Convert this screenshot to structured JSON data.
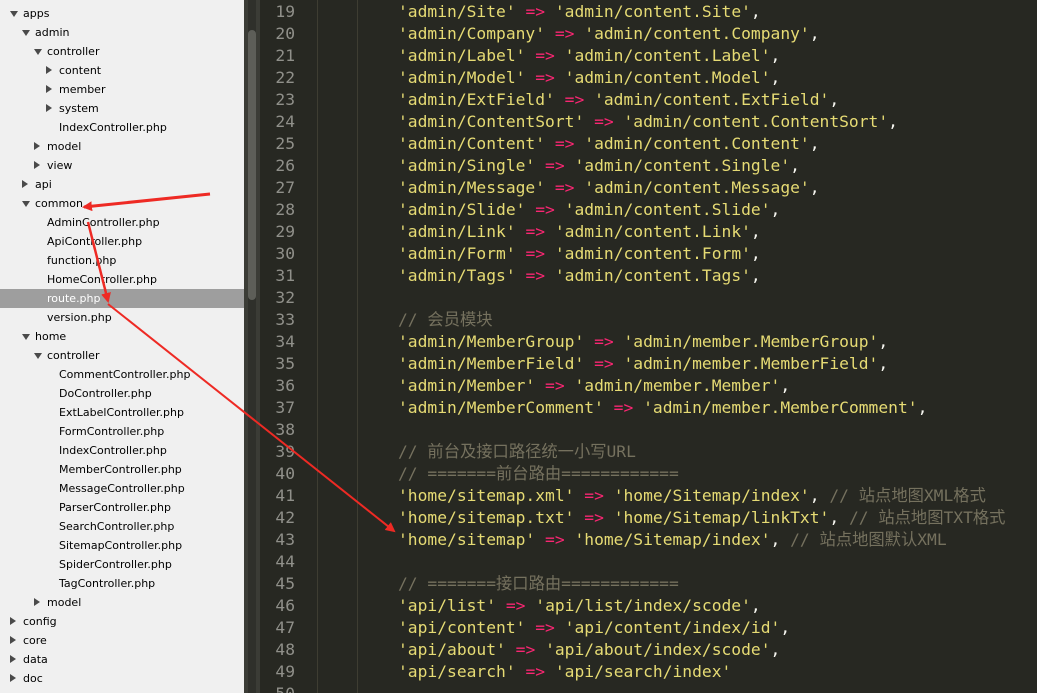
{
  "sidebar": {
    "items": [
      {
        "label": "apps",
        "state": "open",
        "selected": false
      },
      {
        "label": "admin",
        "state": "open",
        "selected": false
      },
      {
        "label": "controller",
        "state": "open",
        "selected": false
      },
      {
        "label": "content",
        "state": "closed",
        "selected": false
      },
      {
        "label": "member",
        "state": "closed",
        "selected": false
      },
      {
        "label": "system",
        "state": "closed",
        "selected": false
      },
      {
        "label": "IndexController.php",
        "state": "file",
        "selected": false
      },
      {
        "label": "model",
        "state": "closed",
        "selected": false
      },
      {
        "label": "view",
        "state": "closed",
        "selected": false
      },
      {
        "label": "api",
        "state": "closed",
        "selected": false
      },
      {
        "label": "common",
        "state": "open",
        "selected": false
      },
      {
        "label": "AdminController.php",
        "state": "file",
        "selected": false
      },
      {
        "label": "ApiController.php",
        "state": "file",
        "selected": false
      },
      {
        "label": "function.php",
        "state": "file",
        "selected": false
      },
      {
        "label": "HomeController.php",
        "state": "file",
        "selected": false
      },
      {
        "label": "route.php",
        "state": "file",
        "selected": true
      },
      {
        "label": "version.php",
        "state": "file",
        "selected": false
      },
      {
        "label": "home",
        "state": "open",
        "selected": false
      },
      {
        "label": "controller",
        "state": "open",
        "selected": false
      },
      {
        "label": "CommentController.php",
        "state": "file",
        "selected": false
      },
      {
        "label": "DoController.php",
        "state": "file",
        "selected": false
      },
      {
        "label": "ExtLabelController.php",
        "state": "file",
        "selected": false
      },
      {
        "label": "FormController.php",
        "state": "file",
        "selected": false
      },
      {
        "label": "IndexController.php",
        "state": "file",
        "selected": false
      },
      {
        "label": "MemberController.php",
        "state": "file",
        "selected": false
      },
      {
        "label": "MessageController.php",
        "state": "file",
        "selected": false
      },
      {
        "label": "ParserController.php",
        "state": "file",
        "selected": false
      },
      {
        "label": "SearchController.php",
        "state": "file",
        "selected": false
      },
      {
        "label": "SitemapController.php",
        "state": "file",
        "selected": false
      },
      {
        "label": "SpiderController.php",
        "state": "file",
        "selected": false
      },
      {
        "label": "TagController.php",
        "state": "file",
        "selected": false
      },
      {
        "label": "model",
        "state": "closed",
        "selected": false
      },
      {
        "label": "config",
        "state": "closed",
        "selected": false
      },
      {
        "label": "core",
        "state": "closed",
        "selected": false
      },
      {
        "label": "data",
        "state": "closed",
        "selected": false
      },
      {
        "label": "doc",
        "state": "closed",
        "selected": false
      }
    ]
  },
  "editor": {
    "lines": [
      {
        "n": "19",
        "parts": [
          [
            "s",
            "'admin/Site'"
          ],
          [
            "p",
            " "
          ],
          [
            "k",
            "=>"
          ],
          [
            "p",
            " "
          ],
          [
            "s",
            "'admin/content.Site'"
          ],
          [
            "p",
            ","
          ]
        ]
      },
      {
        "n": "20",
        "parts": [
          [
            "s",
            "'admin/Company'"
          ],
          [
            "p",
            " "
          ],
          [
            "k",
            "=>"
          ],
          [
            "p",
            " "
          ],
          [
            "s",
            "'admin/content.Company'"
          ],
          [
            "p",
            ","
          ]
        ]
      },
      {
        "n": "21",
        "parts": [
          [
            "s",
            "'admin/Label'"
          ],
          [
            "p",
            " "
          ],
          [
            "k",
            "=>"
          ],
          [
            "p",
            " "
          ],
          [
            "s",
            "'admin/content.Label'"
          ],
          [
            "p",
            ","
          ]
        ]
      },
      {
        "n": "22",
        "parts": [
          [
            "s",
            "'admin/Model'"
          ],
          [
            "p",
            " "
          ],
          [
            "k",
            "=>"
          ],
          [
            "p",
            " "
          ],
          [
            "s",
            "'admin/content.Model'"
          ],
          [
            "p",
            ","
          ]
        ]
      },
      {
        "n": "23",
        "parts": [
          [
            "s",
            "'admin/ExtField'"
          ],
          [
            "p",
            " "
          ],
          [
            "k",
            "=>"
          ],
          [
            "p",
            " "
          ],
          [
            "s",
            "'admin/content.ExtField'"
          ],
          [
            "p",
            ","
          ]
        ]
      },
      {
        "n": "24",
        "parts": [
          [
            "s",
            "'admin/ContentSort'"
          ],
          [
            "p",
            " "
          ],
          [
            "k",
            "=>"
          ],
          [
            "p",
            " "
          ],
          [
            "s",
            "'admin/content.ContentSort'"
          ],
          [
            "p",
            ","
          ]
        ]
      },
      {
        "n": "25",
        "parts": [
          [
            "s",
            "'admin/Content'"
          ],
          [
            "p",
            " "
          ],
          [
            "k",
            "=>"
          ],
          [
            "p",
            " "
          ],
          [
            "s",
            "'admin/content.Content'"
          ],
          [
            "p",
            ","
          ]
        ]
      },
      {
        "n": "26",
        "parts": [
          [
            "s",
            "'admin/Single'"
          ],
          [
            "p",
            " "
          ],
          [
            "k",
            "=>"
          ],
          [
            "p",
            " "
          ],
          [
            "s",
            "'admin/content.Single'"
          ],
          [
            "p",
            ","
          ]
        ]
      },
      {
        "n": "27",
        "parts": [
          [
            "s",
            "'admin/Message'"
          ],
          [
            "p",
            " "
          ],
          [
            "k",
            "=>"
          ],
          [
            "p",
            " "
          ],
          [
            "s",
            "'admin/content.Message'"
          ],
          [
            "p",
            ","
          ]
        ]
      },
      {
        "n": "28",
        "parts": [
          [
            "s",
            "'admin/Slide'"
          ],
          [
            "p",
            " "
          ],
          [
            "k",
            "=>"
          ],
          [
            "p",
            " "
          ],
          [
            "s",
            "'admin/content.Slide'"
          ],
          [
            "p",
            ","
          ]
        ]
      },
      {
        "n": "29",
        "parts": [
          [
            "s",
            "'admin/Link'"
          ],
          [
            "p",
            " "
          ],
          [
            "k",
            "=>"
          ],
          [
            "p",
            " "
          ],
          [
            "s",
            "'admin/content.Link'"
          ],
          [
            "p",
            ","
          ]
        ]
      },
      {
        "n": "30",
        "parts": [
          [
            "s",
            "'admin/Form'"
          ],
          [
            "p",
            " "
          ],
          [
            "k",
            "=>"
          ],
          [
            "p",
            " "
          ],
          [
            "s",
            "'admin/content.Form'"
          ],
          [
            "p",
            ","
          ]
        ]
      },
      {
        "n": "31",
        "parts": [
          [
            "s",
            "'admin/Tags'"
          ],
          [
            "p",
            " "
          ],
          [
            "k",
            "=>"
          ],
          [
            "p",
            " "
          ],
          [
            "s",
            "'admin/content.Tags'"
          ],
          [
            "p",
            ","
          ]
        ]
      },
      {
        "n": "32",
        "parts": []
      },
      {
        "n": "33",
        "parts": [
          [
            "c",
            "// 会员模块"
          ]
        ]
      },
      {
        "n": "34",
        "parts": [
          [
            "s",
            "'admin/MemberGroup'"
          ],
          [
            "p",
            " "
          ],
          [
            "k",
            "=>"
          ],
          [
            "p",
            " "
          ],
          [
            "s",
            "'admin/member.MemberGroup'"
          ],
          [
            "p",
            ","
          ]
        ]
      },
      {
        "n": "35",
        "parts": [
          [
            "s",
            "'admin/MemberField'"
          ],
          [
            "p",
            " "
          ],
          [
            "k",
            "=>"
          ],
          [
            "p",
            " "
          ],
          [
            "s",
            "'admin/member.MemberField'"
          ],
          [
            "p",
            ","
          ]
        ]
      },
      {
        "n": "36",
        "parts": [
          [
            "s",
            "'admin/Member'"
          ],
          [
            "p",
            " "
          ],
          [
            "k",
            "=>"
          ],
          [
            "p",
            " "
          ],
          [
            "s",
            "'admin/member.Member'"
          ],
          [
            "p",
            ","
          ]
        ]
      },
      {
        "n": "37",
        "parts": [
          [
            "s",
            "'admin/MemberComment'"
          ],
          [
            "p",
            " "
          ],
          [
            "k",
            "=>"
          ],
          [
            "p",
            " "
          ],
          [
            "s",
            "'admin/member.MemberComment'"
          ],
          [
            "p",
            ","
          ]
        ]
      },
      {
        "n": "38",
        "parts": []
      },
      {
        "n": "39",
        "parts": [
          [
            "c",
            "// 前台及接口路径统一小写URL"
          ]
        ]
      },
      {
        "n": "40",
        "parts": [
          [
            "c",
            "// =======前台路由============"
          ]
        ]
      },
      {
        "n": "41",
        "parts": [
          [
            "s",
            "'home/sitemap.xml'"
          ],
          [
            "p",
            " "
          ],
          [
            "k",
            "=>"
          ],
          [
            "p",
            " "
          ],
          [
            "s",
            "'home/Sitemap/index'"
          ],
          [
            "p",
            ", "
          ],
          [
            "c",
            "// 站点地图XML格式"
          ]
        ]
      },
      {
        "n": "42",
        "parts": [
          [
            "s",
            "'home/sitemap.txt'"
          ],
          [
            "p",
            " "
          ],
          [
            "k",
            "=>"
          ],
          [
            "p",
            " "
          ],
          [
            "s",
            "'home/Sitemap/linkTxt'"
          ],
          [
            "p",
            ", "
          ],
          [
            "c",
            "// 站点地图TXT格式"
          ]
        ]
      },
      {
        "n": "43",
        "parts": [
          [
            "s",
            "'home/sitemap'"
          ],
          [
            "p",
            " "
          ],
          [
            "k",
            "=>"
          ],
          [
            "p",
            " "
          ],
          [
            "s",
            "'home/Sitemap/index'"
          ],
          [
            "p",
            ", "
          ],
          [
            "c",
            "// 站点地图默认XML"
          ]
        ]
      },
      {
        "n": "44",
        "parts": []
      },
      {
        "n": "45",
        "parts": [
          [
            "c",
            "// =======接口路由============"
          ]
        ]
      },
      {
        "n": "46",
        "parts": [
          [
            "s",
            "'api/list'"
          ],
          [
            "p",
            " "
          ],
          [
            "k",
            "=>"
          ],
          [
            "p",
            " "
          ],
          [
            "s",
            "'api/list/index/scode'"
          ],
          [
            "p",
            ","
          ]
        ]
      },
      {
        "n": "47",
        "parts": [
          [
            "s",
            "'api/content'"
          ],
          [
            "p",
            " "
          ],
          [
            "k",
            "=>"
          ],
          [
            "p",
            " "
          ],
          [
            "s",
            "'api/content/index/id'"
          ],
          [
            "p",
            ","
          ]
        ]
      },
      {
        "n": "48",
        "parts": [
          [
            "s",
            "'api/about'"
          ],
          [
            "p",
            " "
          ],
          [
            "k",
            "=>"
          ],
          [
            "p",
            " "
          ],
          [
            "s",
            "'api/about/index/scode'"
          ],
          [
            "p",
            ","
          ]
        ]
      },
      {
        "n": "49",
        "parts": [
          [
            "s",
            "'api/search'"
          ],
          [
            "p",
            " "
          ],
          [
            "k",
            "=>"
          ],
          [
            "p",
            " "
          ],
          [
            "s",
            "'api/search/index'"
          ]
        ]
      },
      {
        "n": "50",
        "parts": []
      }
    ]
  },
  "colors": {
    "string": "#e6db74",
    "operator": "#f92672",
    "comment": "#75715e",
    "annotation_arrow": "#ee2a24"
  }
}
